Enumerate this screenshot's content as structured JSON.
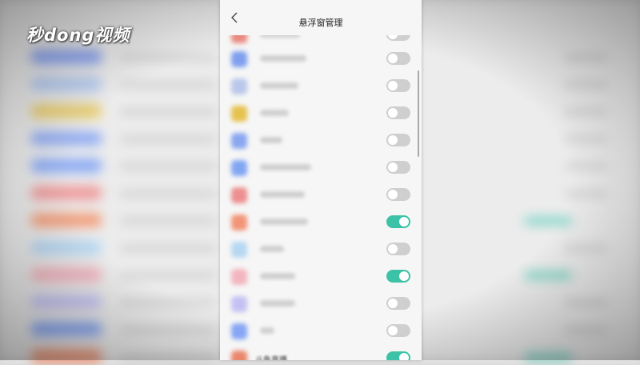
{
  "watermark": {
    "text": "秒dong视频"
  },
  "header": {
    "title": "悬浮窗管理"
  },
  "rows": [
    {
      "icon_color": "#e98a7e",
      "state": "off"
    },
    {
      "icon_color": "#7fa0ee",
      "state": "off"
    },
    {
      "icon_color": "#b9c7ea",
      "state": "off"
    },
    {
      "icon_color": "#e6c24f",
      "state": "off"
    },
    {
      "icon_color": "#8aa8f0",
      "state": "off"
    },
    {
      "icon_color": "#82a6f2",
      "state": "off"
    },
    {
      "icon_color": "#ec8f8f",
      "state": "off"
    },
    {
      "icon_color": "#f29478",
      "state": "on"
    },
    {
      "icon_color": "#b7d8f2",
      "state": "off"
    },
    {
      "icon_color": "#f3b5bf",
      "state": "on"
    },
    {
      "icon_color": "#c4c2f2",
      "state": "off"
    },
    {
      "icon_color": "#86a6f3",
      "state": "off"
    },
    {
      "icon_color": "#e9866b",
      "state": "on",
      "label": "斗鱼直播"
    }
  ],
  "colors": {
    "toggle_on": "#3cc2a6",
    "toggle_off": "#cfcfcf"
  }
}
